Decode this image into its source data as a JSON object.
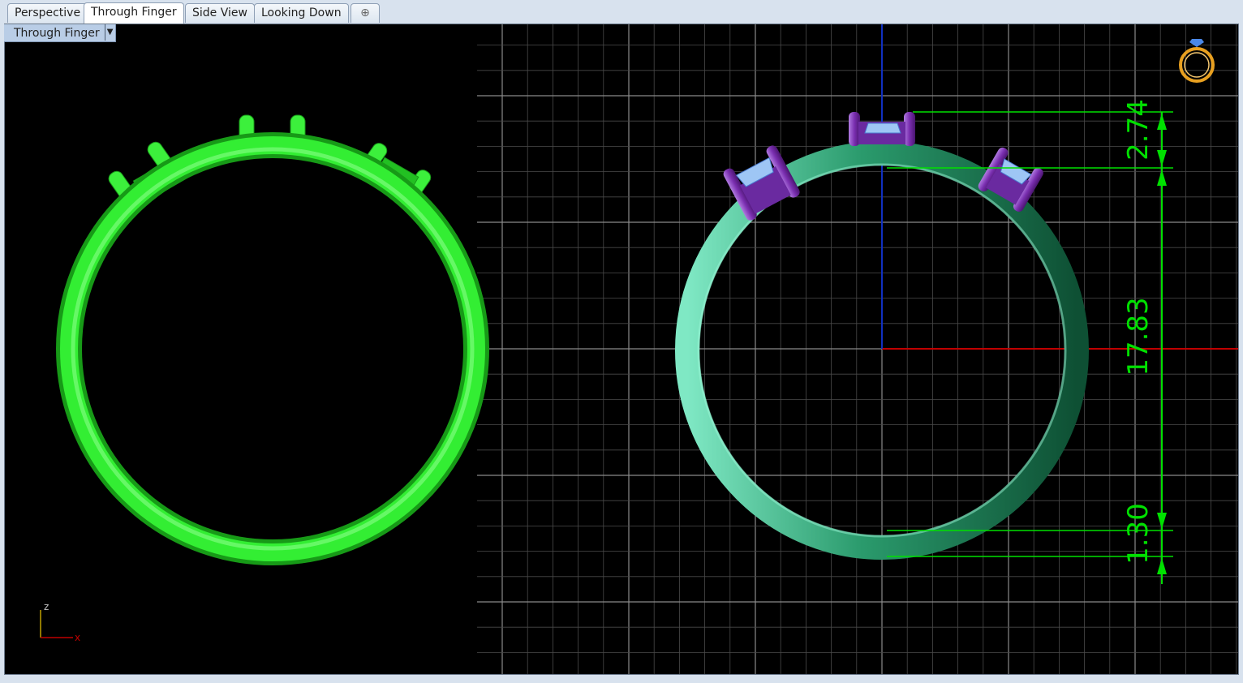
{
  "tabs": [
    {
      "label": "Perspective",
      "active": false
    },
    {
      "label": "Through Finger",
      "active": true
    },
    {
      "label": "Side View",
      "active": false
    },
    {
      "label": "Looking Down",
      "active": false
    }
  ],
  "add_tab_icon": "plus-icon",
  "viewport": {
    "label": "Through Finger",
    "dropdown_icon": "chevron-down-icon",
    "axis_labels": {
      "z": "z",
      "x": "x"
    }
  },
  "dimensions": {
    "top_height": "2.74",
    "inner_diameter": "17.83",
    "band_thickness": "1.30"
  },
  "colors": {
    "ring_left": "#2ee82e",
    "ring_right": "#1e8a5a",
    "prongs": "#7a2fb0",
    "gems": "#9ec6f5",
    "dimension": "#00e000",
    "grid": "#5a5a5a",
    "x_axis": "#c00000",
    "y_axis": "#1030c0",
    "gumball_icon": "#e8a020"
  },
  "icons": {
    "ring_widget": "ring-icon"
  }
}
